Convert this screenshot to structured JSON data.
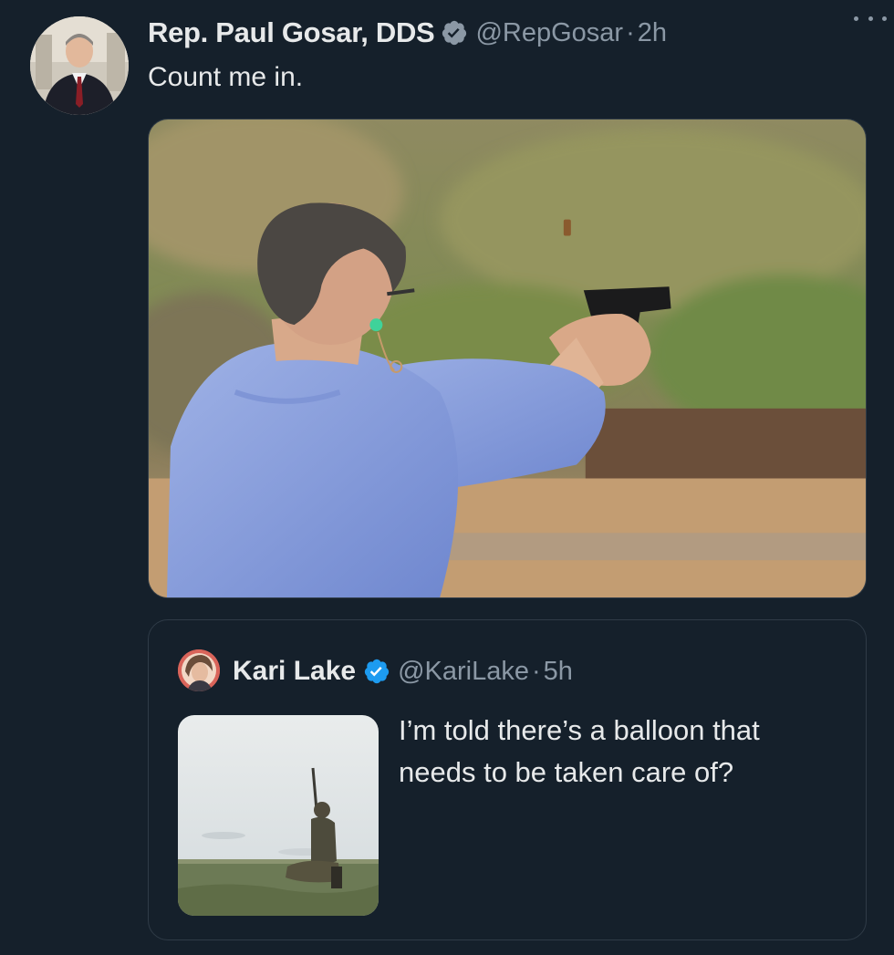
{
  "tweet": {
    "display_name": "Rep. Paul Gosar, DDS",
    "handle": "@RepGosar",
    "separator": "·",
    "time": "2h",
    "text": "Count me in.",
    "avatar_icon": "profile-photo",
    "verified_icon": "verified-badge-icon",
    "more_icon": "more-options-icon"
  },
  "quoted_tweet": {
    "display_name": "Kari Lake",
    "handle": "@KariLake",
    "separator": "·",
    "time": "5h",
    "text": "I’m told there’s a balloon that needs to be taken care of?",
    "avatar_icon": "profile-photo",
    "verified_icon": "verified-badge-icon"
  },
  "colors": {
    "background": "#15202b",
    "primary_text": "#e7e9ea",
    "secondary_text": "#8b98a5",
    "verified_blue": "#1d9bf0",
    "border": "#2f3b47"
  }
}
